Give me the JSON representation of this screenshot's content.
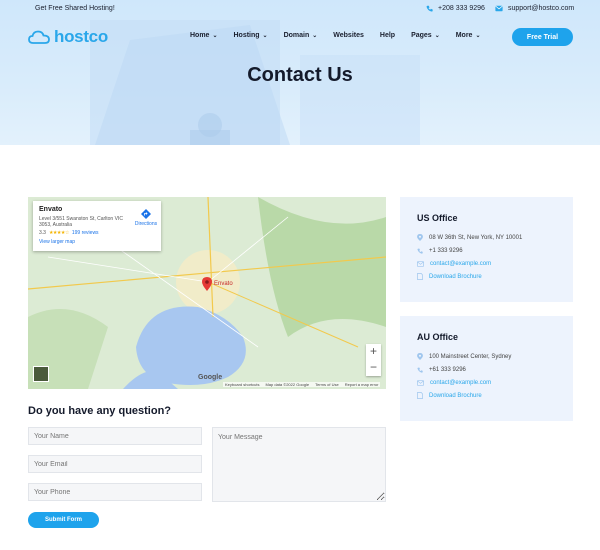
{
  "topbar": {
    "promo": "Get Free Shared Hosting!",
    "phone": "+208 333 9296",
    "email": "support@hostco.com"
  },
  "brand": {
    "logo_text": "hostco",
    "accent": "#2aa7ea"
  },
  "nav": {
    "items": [
      {
        "label": "Home",
        "dropdown": true
      },
      {
        "label": "Hosting",
        "dropdown": true
      },
      {
        "label": "Domain",
        "dropdown": true
      },
      {
        "label": "Websites",
        "dropdown": false
      },
      {
        "label": "Help",
        "dropdown": false
      },
      {
        "label": "Pages",
        "dropdown": true
      },
      {
        "label": "More",
        "dropdown": true
      }
    ],
    "cta": "Free Trial"
  },
  "page": {
    "title": "Contact Us"
  },
  "map": {
    "place_name": "Envato",
    "address": "Level 3/551 Swanston St, Carlton VIC 3053, Australia",
    "rating": "3.3",
    "stars": "★★★★☆",
    "reviews": "199 reviews",
    "directions_label": "Directions",
    "view_larger": "View larger map",
    "pin_label": "Envato",
    "zoom_in": "+",
    "zoom_out": "−",
    "google": "Google",
    "attribution": [
      "Keyboard shortcuts",
      "Map data ©2022 Google",
      "Terms of Use",
      "Report a map error"
    ]
  },
  "form": {
    "title": "Do you have any question?",
    "name_placeholder": "Your Name",
    "email_placeholder": "Your Email",
    "phone_placeholder": "Your Phone",
    "message_placeholder": "Your Message",
    "submit": "Submit Form"
  },
  "offices": [
    {
      "title": "US Office",
      "address": "08 W 36th St, New York, NY 10001",
      "phone": "+1 333 9296",
      "email": "contact@example.com",
      "brochure": "Download Brochure"
    },
    {
      "title": "AU Office",
      "address": "100 Mainstreet Center, Sydney",
      "phone": "+61 333 9296",
      "email": "contact@example.com",
      "brochure": "Download Brochure"
    }
  ]
}
